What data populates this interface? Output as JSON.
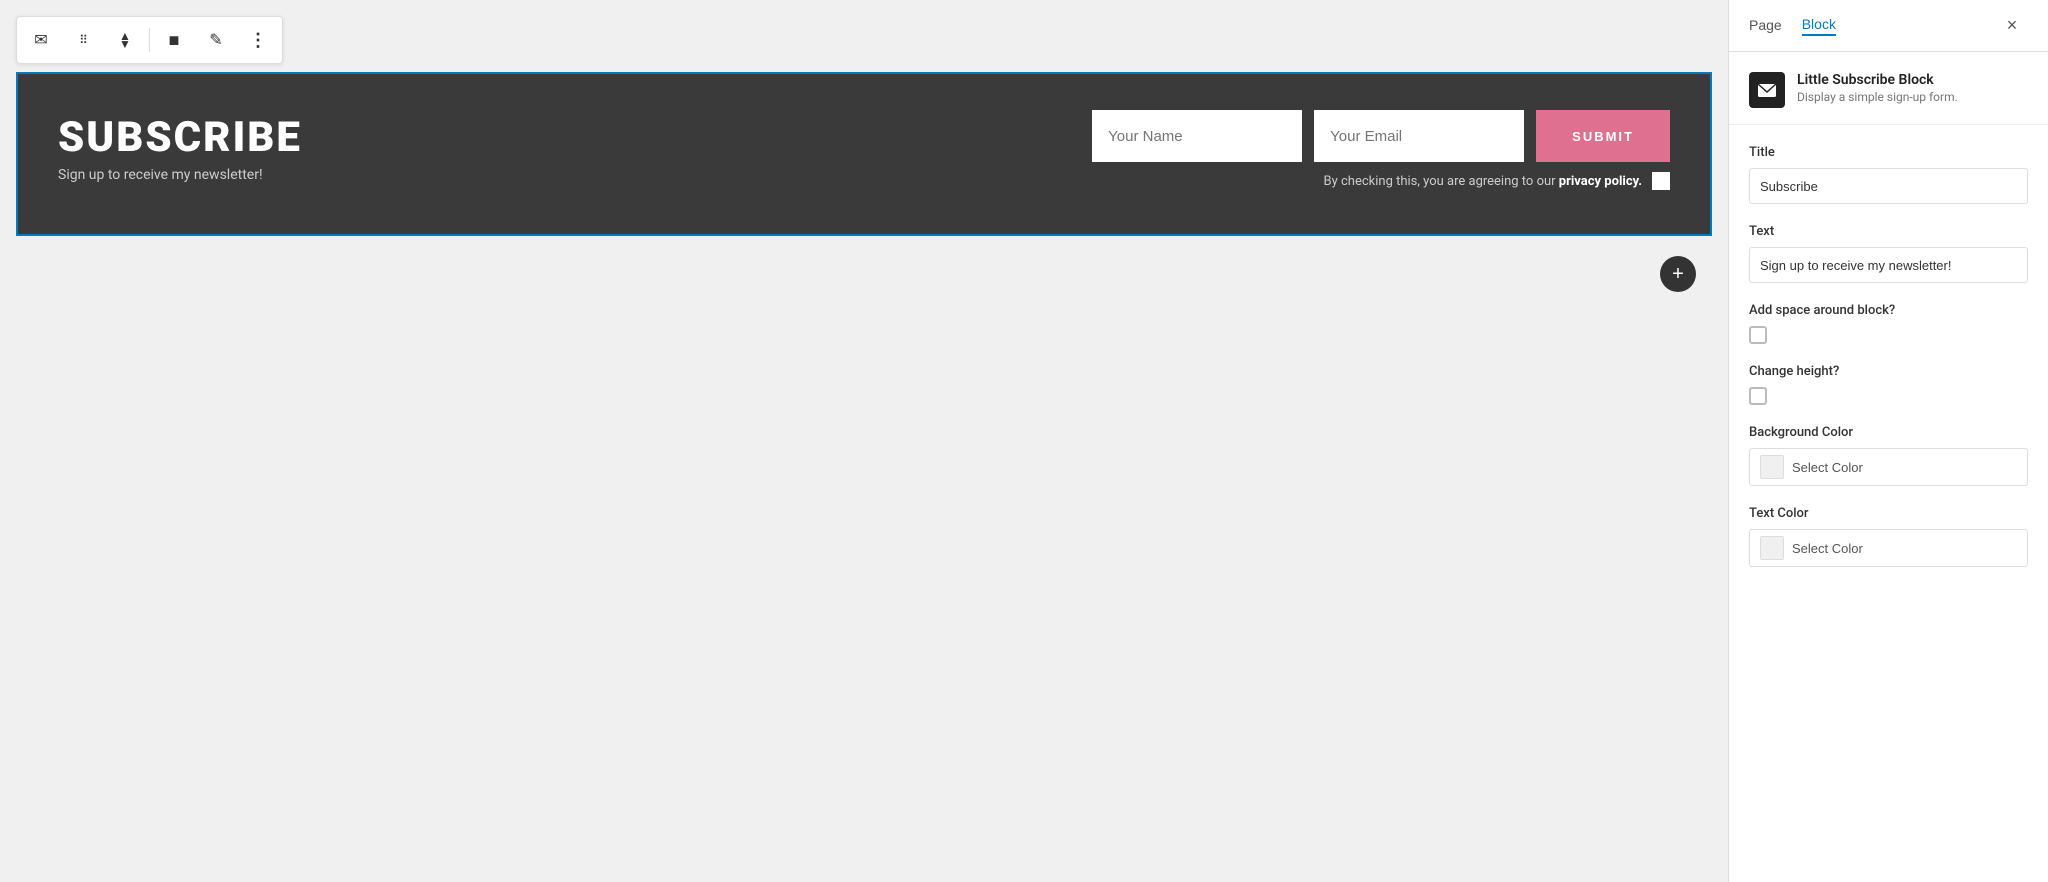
{
  "toolbar": {
    "email_icon": "✉",
    "drag_icon": "⠿",
    "up_down_icon": "⇅",
    "block_icon": "■",
    "edit_icon": "✎",
    "more_icon": "⋮"
  },
  "subscribe_block": {
    "title": "SUBSCRIBE",
    "subtitle": "Sign up to receive my newsletter!",
    "name_placeholder": "Your Name",
    "email_placeholder": "Your Email",
    "submit_label": "SUBMIT",
    "policy_text": "By checking this, you are agreeing to our",
    "policy_link": "privacy policy.",
    "background_color": "#3a3a3a",
    "submit_color": "#e07090"
  },
  "add_block": {
    "label": "+"
  },
  "sidebar": {
    "tab_page": "Page",
    "tab_block": "Block",
    "active_tab": "Block",
    "close_icon": "×",
    "block_name": "Little Subscribe Block",
    "block_description": "Display a simple sign-up form.",
    "title_label": "Title",
    "title_value": "Subscribe",
    "text_label": "Text",
    "text_value": "Sign up to receive my newsletter!",
    "add_space_label": "Add space around block?",
    "change_height_label": "Change height?",
    "background_color_label": "Background Color",
    "background_color_btn": "Select Color",
    "text_color_label": "Text Color",
    "text_color_btn": "Select Color"
  }
}
